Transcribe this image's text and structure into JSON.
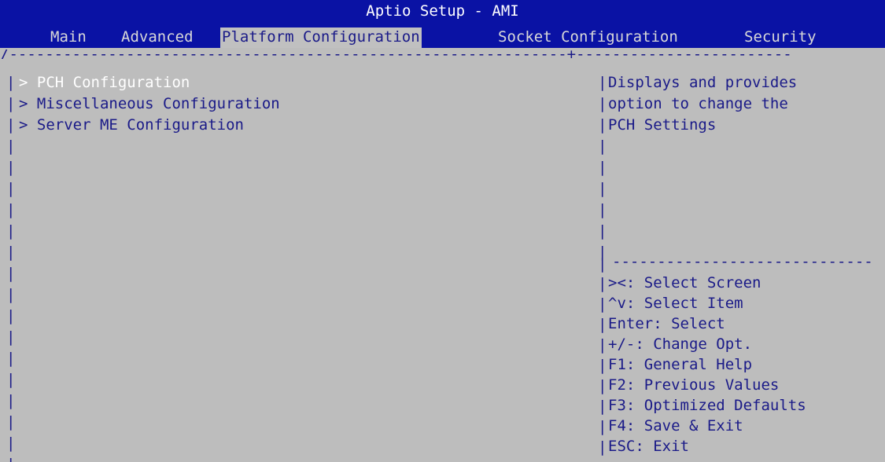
{
  "window": {
    "title": "Aptio Setup - AMI"
  },
  "tabs": [
    {
      "label": "Main",
      "active": false
    },
    {
      "label": "Advanced",
      "active": false
    },
    {
      "label": "Platform Configuration",
      "active": true
    },
    {
      "label": "Socket Configuration",
      "active": false
    },
    {
      "label": "Security",
      "active": false
    }
  ],
  "menu": {
    "items": [
      {
        "label": "> PCH Configuration",
        "selected": true
      },
      {
        "label": "> Miscellaneous Configuration",
        "selected": false
      },
      {
        "label": "> Server ME Configuration",
        "selected": false
      }
    ]
  },
  "help": {
    "lines": [
      "Displays and provides",
      "option to change the",
      "PCH Settings"
    ]
  },
  "keys": [
    "><: Select Screen",
    "^v: Select Item",
    "Enter: Select",
    "+/-: Change Opt.",
    "F1: General Help",
    "F2: Previous Values",
    "F3: Optimized Defaults",
    "F4: Save & Exit",
    "ESC: Exit"
  ],
  "colors": {
    "title_bar": "#0a12a4",
    "background": "#bdbdbd",
    "text": "#1a1a88",
    "selected_text": "#ffffff"
  }
}
